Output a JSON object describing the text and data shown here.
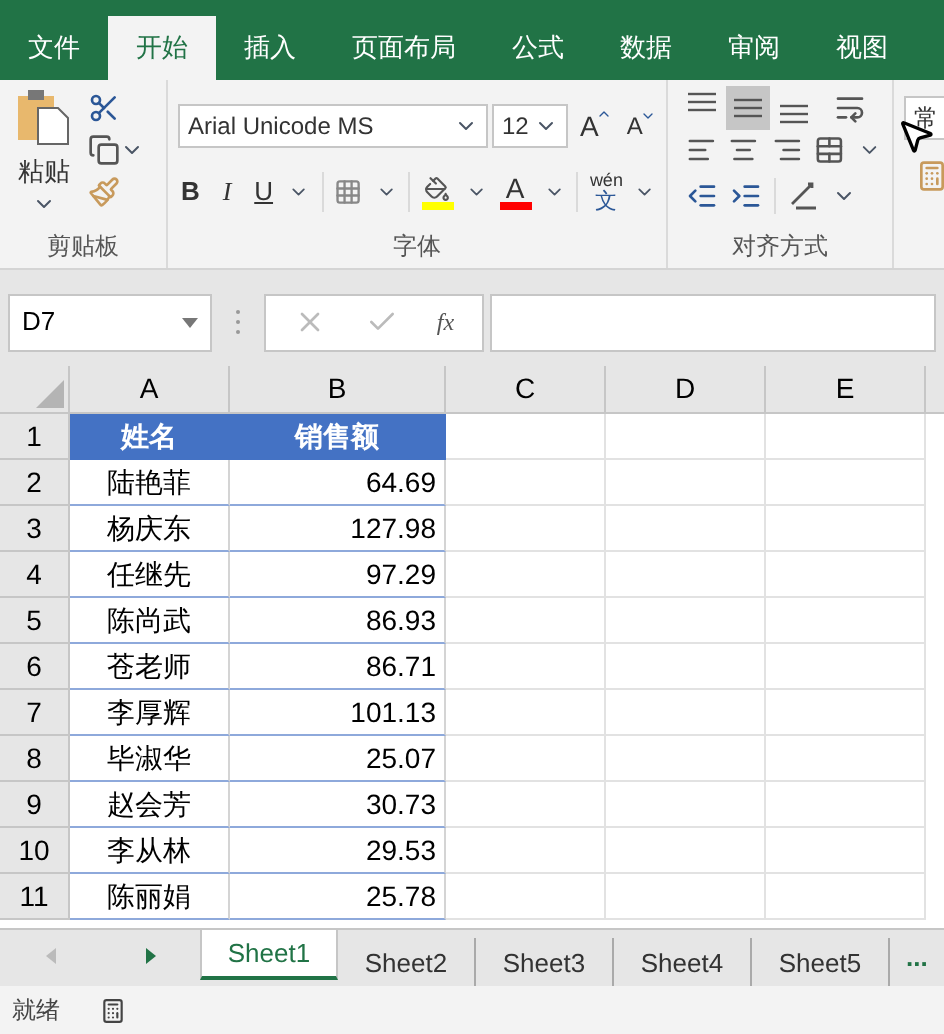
{
  "ribbon_tabs": [
    {
      "label": "文件",
      "selected": false
    },
    {
      "label": "开始",
      "selected": true
    },
    {
      "label": "插入",
      "selected": false
    },
    {
      "label": "页面布局",
      "selected": false
    },
    {
      "label": "公式",
      "selected": false
    },
    {
      "label": "数据",
      "selected": false
    },
    {
      "label": "审阅",
      "selected": false
    },
    {
      "label": "视图",
      "selected": false
    }
  ],
  "clipboard": {
    "paste_label": "粘贴",
    "group_label": "剪贴板"
  },
  "font": {
    "name": "Arial Unicode MS",
    "size": "12",
    "grow": "A",
    "shrink": "A",
    "bold": "B",
    "italic": "I",
    "underline": "U",
    "font_color": "A",
    "phonetic_top": "wén",
    "phonetic_bottom": "文",
    "group_label": "字体"
  },
  "alignment": {
    "vertical": [
      {
        "selected": false
      },
      {
        "selected": true
      },
      {
        "selected": false
      }
    ],
    "group_label": "对齐方式"
  },
  "number_format": {
    "value": "常"
  },
  "formula_bar": {
    "name_box": "D7",
    "fx": "fx"
  },
  "columns": [
    "A",
    "B",
    "C",
    "D",
    "E"
  ],
  "rows": [
    {
      "number": "1",
      "cells": [
        "姓名",
        "销售额"
      ],
      "kind": "header"
    },
    {
      "number": "2",
      "cells": [
        "陆艳菲",
        "64.69"
      ],
      "kind": "data"
    },
    {
      "number": "3",
      "cells": [
        "杨庆东",
        "127.98"
      ],
      "kind": "data"
    },
    {
      "number": "4",
      "cells": [
        "任继先",
        "97.29"
      ],
      "kind": "data"
    },
    {
      "number": "5",
      "cells": [
        "陈尚武",
        "86.93"
      ],
      "kind": "data"
    },
    {
      "number": "6",
      "cells": [
        "苍老师",
        "86.71"
      ],
      "kind": "data"
    },
    {
      "number": "7",
      "cells": [
        "李厚辉",
        "101.13"
      ],
      "kind": "data"
    },
    {
      "number": "8",
      "cells": [
        "毕淑华",
        "25.07"
      ],
      "kind": "data"
    },
    {
      "number": "9",
      "cells": [
        "赵会芳",
        "30.73"
      ],
      "kind": "data"
    },
    {
      "number": "10",
      "cells": [
        "李从林",
        "29.53"
      ],
      "kind": "data"
    },
    {
      "number": "11",
      "cells": [
        "陈丽娟",
        "25.78"
      ],
      "kind": "data"
    }
  ],
  "sheet_tabs": [
    {
      "label": "Sheet1",
      "selected": true
    },
    {
      "label": "Sheet2",
      "selected": false
    },
    {
      "label": "Sheet3",
      "selected": false
    },
    {
      "label": "Sheet4",
      "selected": false
    },
    {
      "label": "Sheet5",
      "selected": false
    }
  ],
  "more_sheets": "...",
  "status": "就绪"
}
